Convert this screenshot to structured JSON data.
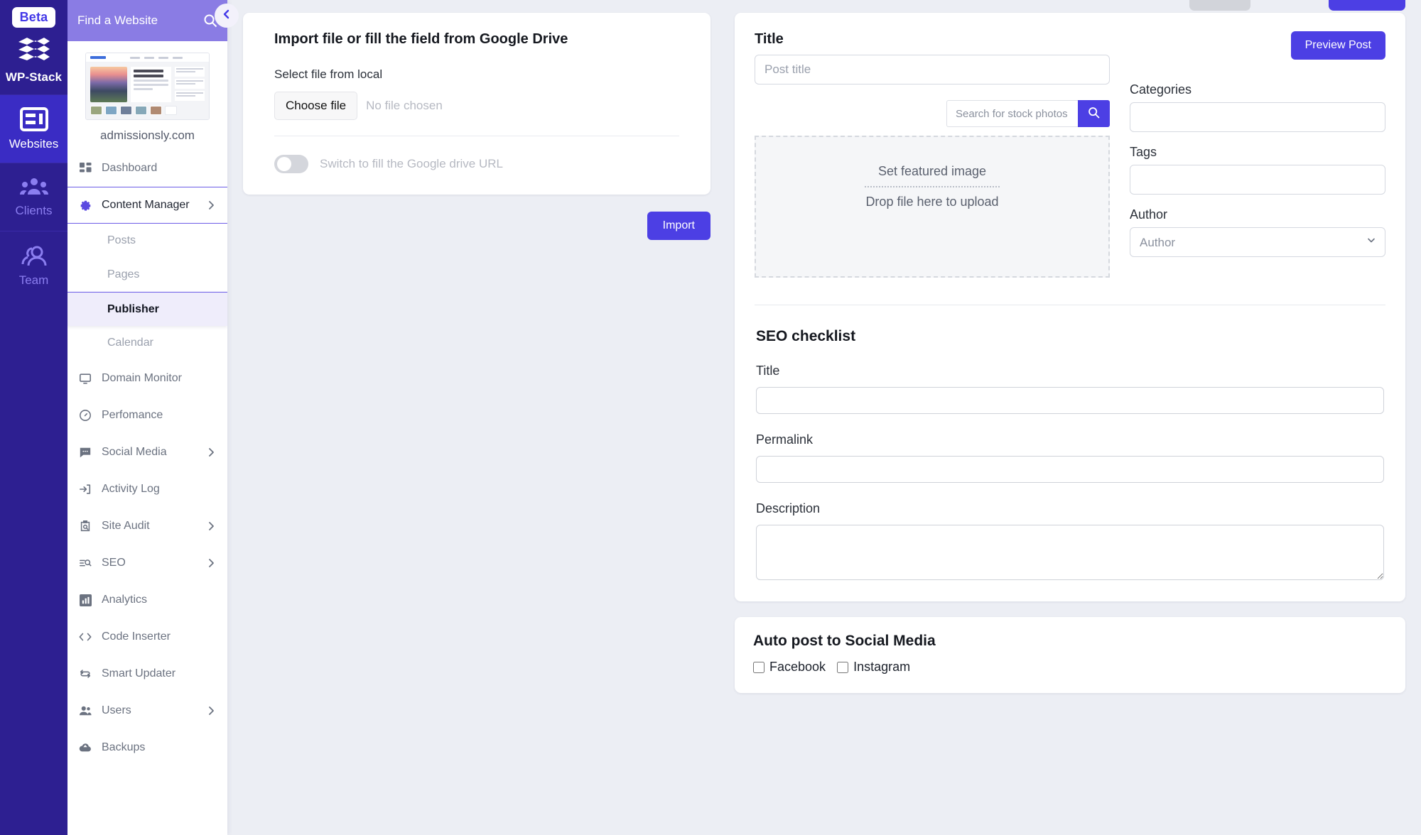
{
  "rail": {
    "beta_badge": "Beta",
    "brand": "WP-Stack",
    "items": [
      {
        "label": "Websites",
        "icon": "websites-icon",
        "active": true
      },
      {
        "label": "Clients",
        "icon": "clients-icon",
        "active": false
      },
      {
        "label": "Team",
        "icon": "team-icon",
        "active": false
      }
    ]
  },
  "sidebar": {
    "search_placeholder": "Find a Website",
    "search_value": "Find a Website",
    "collapse_icon": "chevron-left-icon",
    "site_name": "admissionsly.com",
    "nav": [
      {
        "label": "Dashboard",
        "icon": "dashboard-icon",
        "type": "item",
        "chevron": false
      },
      {
        "label": "Content Manager",
        "icon": "gear-icon",
        "type": "group",
        "chevron": true
      },
      {
        "label": "Posts",
        "icon": "",
        "type": "sub",
        "chevron": false
      },
      {
        "label": "Pages",
        "icon": "",
        "type": "sub",
        "chevron": false
      },
      {
        "label": "Publisher",
        "icon": "",
        "type": "sub-active",
        "chevron": false
      },
      {
        "label": "Calendar",
        "icon": "",
        "type": "sub",
        "chevron": false
      },
      {
        "label": "Domain Monitor",
        "icon": "monitor-icon",
        "type": "item",
        "chevron": false
      },
      {
        "label": "Perfomance",
        "icon": "speedometer-icon",
        "type": "item",
        "chevron": false
      },
      {
        "label": "Social Media",
        "icon": "chat-icon",
        "type": "item",
        "chevron": true
      },
      {
        "label": "Activity Log",
        "icon": "login-arrow-icon",
        "type": "item",
        "chevron": false
      },
      {
        "label": "Site Audit",
        "icon": "clipboard-search-icon",
        "type": "item",
        "chevron": true
      },
      {
        "label": "SEO",
        "icon": "seo-search-icon",
        "type": "item",
        "chevron": true
      },
      {
        "label": "Analytics",
        "icon": "bar-chart-icon",
        "type": "item",
        "chevron": false
      },
      {
        "label": "Code Inserter",
        "icon": "code-brackets-icon",
        "type": "item",
        "chevron": false
      },
      {
        "label": "Smart Updater",
        "icon": "refresh-icon",
        "type": "item",
        "chevron": false
      },
      {
        "label": "Users",
        "icon": "users-icon",
        "type": "item",
        "chevron": true
      },
      {
        "label": "Backups",
        "icon": "cloud-upload-icon",
        "type": "item",
        "chevron": false
      }
    ]
  },
  "import_panel": {
    "title": "Import file or fill the field from Google Drive",
    "select_label": "Select file from local",
    "choose_file_label": "Choose file",
    "no_file_text": "No file chosen",
    "toggle_label": "Switch to fill the Google drive URL",
    "toggle_on": false,
    "import_button": "Import"
  },
  "editor": {
    "title_label": "Title",
    "title_placeholder": "Post title",
    "title_value": "",
    "stock_search_placeholder": "Search for stock photos",
    "stock_search_value": "",
    "search_icon": "search-icon",
    "dropzone_title": "Set featured image",
    "dropzone_subtitle": "Drop file here to upload",
    "preview_button": "Preview Post",
    "categories_label": "Categories",
    "categories_value": "",
    "tags_label": "Tags",
    "tags_value": "",
    "author_label": "Author",
    "author_selected": "Author",
    "author_options": [
      "Author"
    ]
  },
  "seo": {
    "heading": "SEO checklist",
    "fields": [
      {
        "label": "Title",
        "value": "",
        "type": "input"
      },
      {
        "label": "Permalink",
        "value": "",
        "type": "input"
      },
      {
        "label": "Description",
        "value": "",
        "type": "textarea"
      }
    ]
  },
  "social": {
    "heading": "Auto post to Social Media",
    "options": [
      {
        "label": "Facebook",
        "checked": false
      },
      {
        "label": "Instagram",
        "checked": false
      }
    ]
  },
  "colors": {
    "accent": "#4c3fe4",
    "rail_bg": "#2d1f91",
    "rail_active": "#3a2cc4",
    "sidebar_header": "#8a7ce4",
    "page_bg": "#eceef4",
    "active_nav_bg": "#efedfb"
  }
}
